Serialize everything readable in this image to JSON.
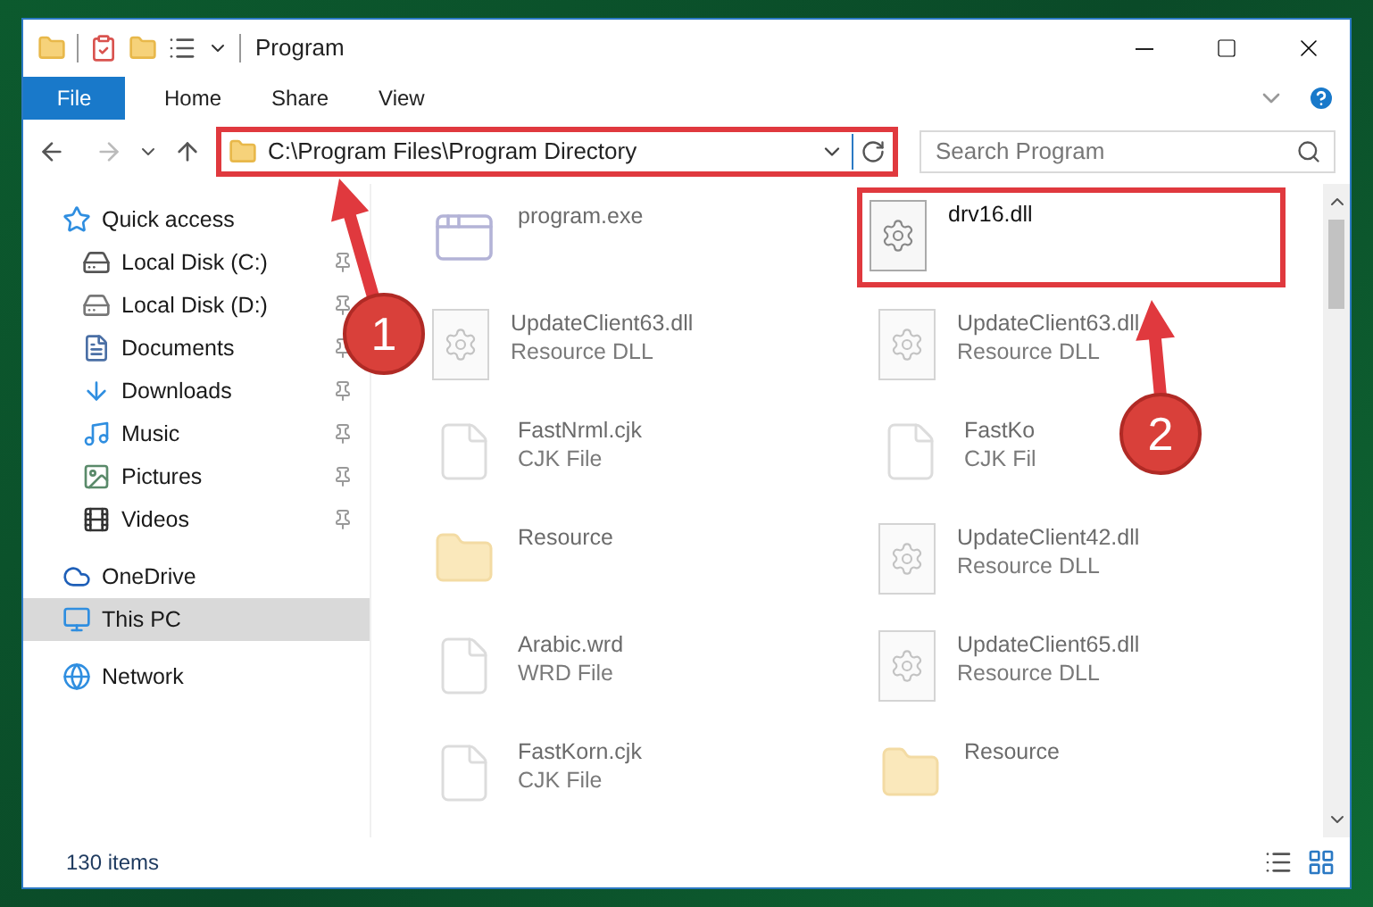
{
  "window": {
    "title": "Program"
  },
  "ribbon_tabs": [
    {
      "label": "File",
      "selected": true
    },
    {
      "label": "Home",
      "selected": false
    },
    {
      "label": "Share",
      "selected": false
    },
    {
      "label": "View",
      "selected": false
    }
  ],
  "address_bar": {
    "value": "C:\\Program Files\\Program Directory",
    "highlighted": true
  },
  "search": {
    "placeholder": "Search Program"
  },
  "sidebar": {
    "items": [
      {
        "label": "Quick access",
        "selected": false,
        "children": [
          {
            "label": "Local Disk (C:)",
            "pinned": true,
            "selected": false
          },
          {
            "label": "Local Disk (D:)",
            "pinned": true,
            "selected": false
          },
          {
            "label": "Documents",
            "pinned": true,
            "selected": false
          },
          {
            "label": "Downloads",
            "pinned": true,
            "selected": false
          },
          {
            "label": "Music",
            "pinned": true,
            "selected": false
          },
          {
            "label": "Pictures",
            "pinned": true,
            "selected": false
          },
          {
            "label": "Videos",
            "pinned": true,
            "selected": false
          }
        ]
      },
      {
        "label": "OneDrive",
        "selected": false
      },
      {
        "label": "This PC",
        "selected": true
      },
      {
        "label": "Network",
        "selected": false
      }
    ]
  },
  "files": [
    {
      "name": "program.exe",
      "kind": "exe",
      "faded": true
    },
    {
      "name": "drv16.dll",
      "kind": "dll",
      "faded": false,
      "highlighted": true
    },
    {
      "name": "UpdateClient63.dll",
      "type": "Resource DLL",
      "kind": "dll",
      "faded": true
    },
    {
      "name": "UpdateClient63.dll",
      "type": "Resource DLL",
      "kind": "dll",
      "faded": true
    },
    {
      "name": "FastNrml.cjk",
      "type": "CJK File",
      "kind": "file",
      "faded": true
    },
    {
      "name": "FastKo",
      "type": "CJK Fil",
      "kind": "file",
      "faded": true
    },
    {
      "name": "Resource",
      "kind": "folder",
      "faded": true
    },
    {
      "name": "UpdateClient42.dll",
      "type": "Resource DLL",
      "kind": "dll",
      "faded": true
    },
    {
      "name": "Arabic.wrd",
      "type": "WRD File",
      "kind": "file",
      "faded": true
    },
    {
      "name": "UpdateClient65.dll",
      "type": "Resource DLL",
      "kind": "dll",
      "faded": true
    },
    {
      "name": "FastKorn.cjk",
      "type": "CJK File",
      "kind": "file",
      "faded": true
    },
    {
      "name": "Resource",
      "kind": "folder",
      "faded": true
    }
  ],
  "annotations": [
    {
      "label": "1"
    },
    {
      "label": "2"
    }
  ],
  "status_bar": {
    "item_count": "130 items"
  }
}
